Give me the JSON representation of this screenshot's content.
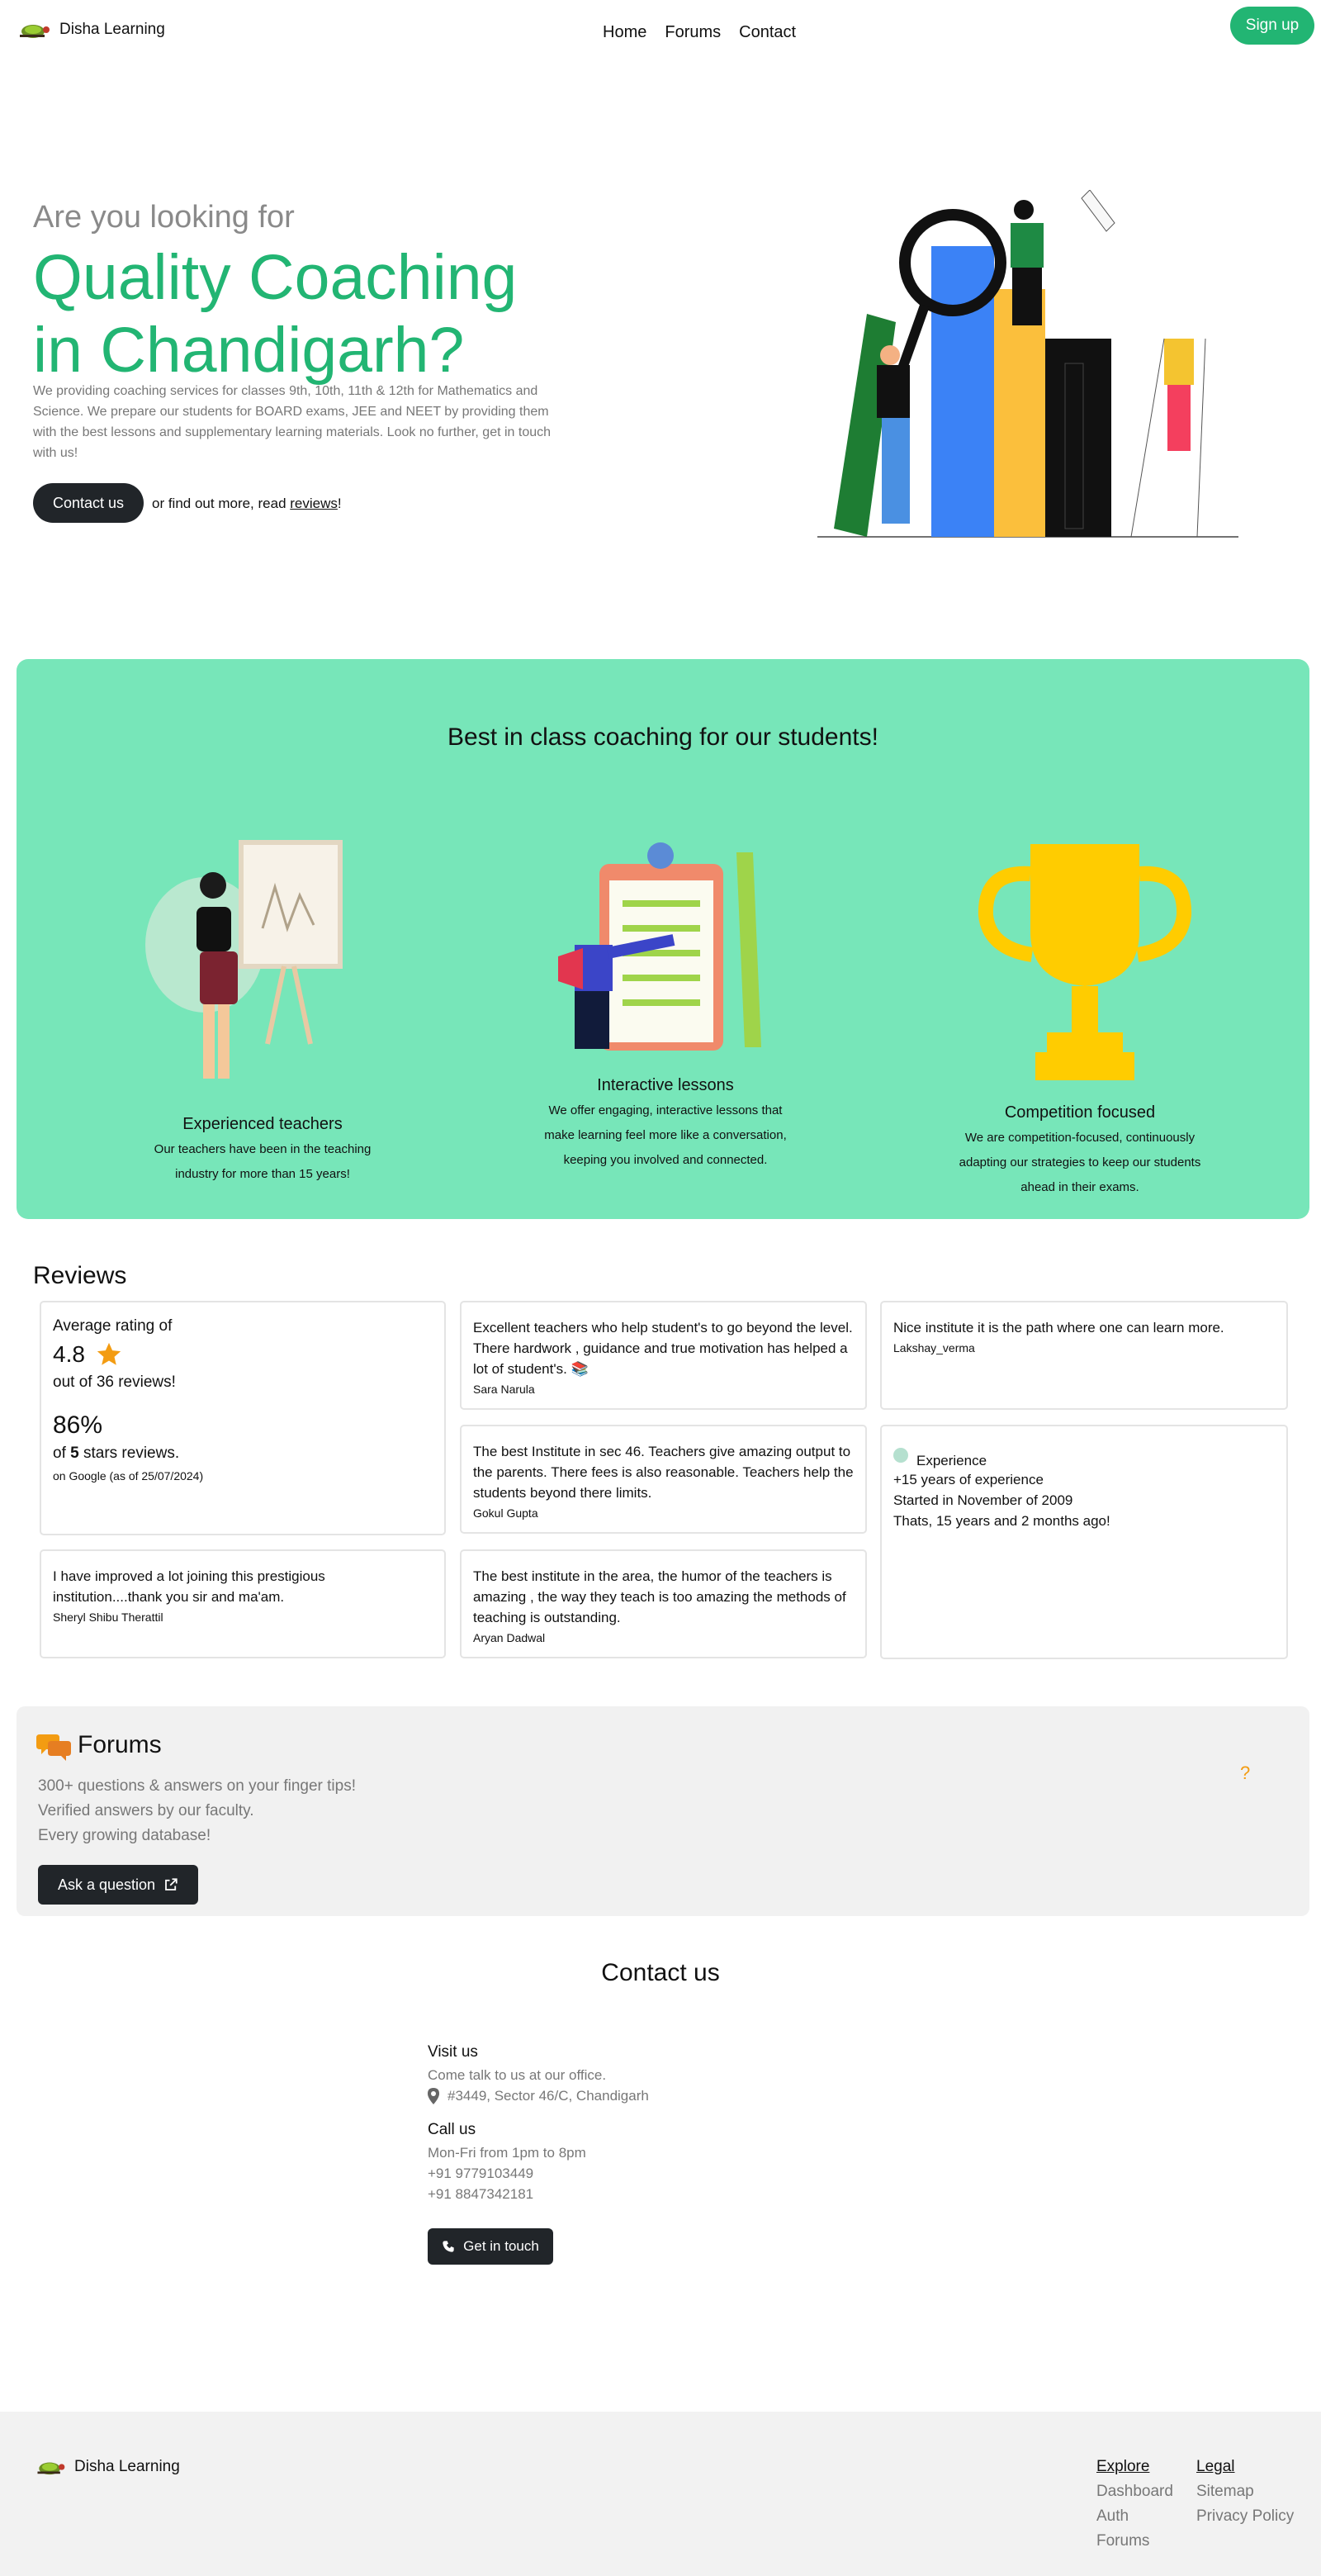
{
  "nav": {
    "brand": "Disha Learning",
    "links": [
      "Home",
      "Forums",
      "Contact"
    ],
    "signup": "Sign up"
  },
  "hero": {
    "pre": "Are you looking for",
    "title_line1": "Quality Coaching",
    "title_line2": "in Chandigarh?",
    "description": "We providing coaching services for classes 9th, 10th, 11th & 12th for Mathematics and Science. We prepare our students for BOARD exams, JEE and NEET by providing them with the best lessons and supplementary learning materials. Look no further, get in touch with us!",
    "contact_button": "Contact us",
    "more_prefix": "or find out more, read ",
    "more_link": "reviews",
    "more_suffix": "!"
  },
  "features": {
    "title": "Best in class coaching for our students!",
    "items": [
      {
        "title": "Experienced teachers",
        "desc_line1": "Our teachers have been in the teaching",
        "desc_line2": "industry for more than 15 years!"
      },
      {
        "title": "Interactive lessons",
        "desc_line1": "We offer engaging, interactive lessons that",
        "desc_line2": "make learning feel more like a conversation,",
        "desc_line3": "keeping you involved and connected."
      },
      {
        "title": "Competition focused",
        "desc_line1": "We are competition-focused, continuously",
        "desc_line2": "adapting our strategies to keep our students",
        "desc_line3": "ahead in their exams."
      }
    ]
  },
  "reviews": {
    "heading": "Reviews",
    "rating": {
      "label": "Average rating of",
      "value": "4.8",
      "count_text": "out of 36 reviews!",
      "percent": "86%",
      "of": "of ",
      "five": "5",
      "stars_text": " stars reviews.",
      "source": "on Google (as of 25/07/2024)"
    },
    "items": [
      {
        "text": "Excellent teachers who help student's to go beyond the level. There hardwork , guidance and true motivation has helped a lot of student's. 📚",
        "author": "Sara Narula"
      },
      {
        "text": "Nice institute it is the path where one can learn more.",
        "author": "Lakshay_verma"
      },
      {
        "text": "The best Institute in sec 46. Teachers give amazing output to the parents. There fees is also reasonable. Teachers help the students beyond there limits.",
        "author": "Gokul Gupta"
      },
      {
        "text": "I have improved a lot joining this prestigious institution....thank you sir and ma'am.",
        "author": "Sheryl Shibu Therattil"
      },
      {
        "text": "The best institute in the area, the humor of the teachers is amazing , the way they teach is too amazing the methods of teaching is outstanding.",
        "author": "Aryan Dadwal"
      }
    ],
    "experience": {
      "label": "Experience",
      "years": "+15 years of experience",
      "started": "Started in November of 2009",
      "since": "Thats, 15 years and 2 months ago!"
    }
  },
  "forums": {
    "title": "Forums",
    "line1": "300+ questions & answers on your finger tips!",
    "line2": "Verified answers by our faculty.",
    "line3": "Every growing database!",
    "button": "Ask a question",
    "mark": "?"
  },
  "contact": {
    "heading": "Contact us",
    "visit_title": "Visit us",
    "visit_sub": "Come talk to us at our office.",
    "address": "#3449, Sector 46/C, Chandigarh",
    "call_title": "Call us",
    "hours": "Mon-Fri from 1pm to 8pm",
    "phone1": "+91 9779103449",
    "phone2": "+91 8847342181",
    "button": "Get in touch"
  },
  "footer": {
    "brand": "Disha Learning",
    "explore_title": "Explore",
    "explore_links": [
      "Dashboard",
      "Auth",
      "Forums"
    ],
    "legal_title": "Legal",
    "legal_links": [
      "Sitemap",
      "Privacy Policy"
    ]
  },
  "colors": {
    "accent": "#22b573",
    "feature_bg": "#77e6b9",
    "dark_button": "#212529",
    "star": "#f39c12"
  }
}
